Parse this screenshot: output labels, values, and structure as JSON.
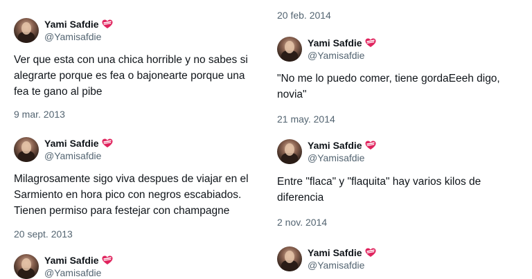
{
  "profile": {
    "name": "Yami Safdie",
    "handle": "@Yamisafdie"
  },
  "tweets_left": [
    {
      "text": "Ver que esta con una chica horrible y no sabes si alegrarte porque es fea o bajonearte porque una fea te gano al pibe",
      "date": "9 mar. 2013"
    },
    {
      "text": "Milagrosamente sigo viva despues de viajar en el Sarmiento en hora pico con negros escabiados. Tienen permiso para festejar con champagne",
      "date": "20 sept. 2013"
    },
    {
      "text": "",
      "date": ""
    }
  ],
  "tweets_right": [
    {
      "text": "",
      "date": "20 feb. 2014"
    },
    {
      "text": "\"No me lo puedo comer, tiene gordaEeeh digo, novia\"",
      "date": "21 may. 2014"
    },
    {
      "text": "Entre \"flaca\" y \"flaquita\" hay varios kilos de diferencia",
      "date": "2 nov. 2014"
    },
    {
      "text": "",
      "date": ""
    }
  ],
  "colors": {
    "text": "#0f1419",
    "secondary": "#536471",
    "heart": "#e0245e"
  },
  "icons": {
    "verified": "heart-badge-icon"
  }
}
